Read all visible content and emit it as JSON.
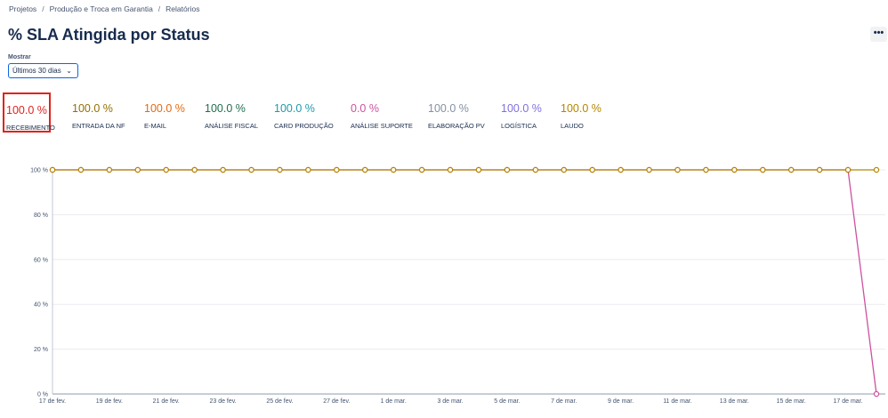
{
  "breadcrumb": [
    "Projetos",
    "Produção e Troca em Garantia",
    "Relatórios"
  ],
  "page_title": "% SLA Atingida por Status",
  "more_label": "•••",
  "filter": {
    "label": "Mostrar",
    "selected": "Últimos 30 dias"
  },
  "stats": [
    {
      "value": "100.0 %",
      "label": "RECEBIMENTO",
      "color": "#e0231c"
    },
    {
      "value": "100.0 %",
      "label": "ENTRADA DA NF",
      "color": "#946f00"
    },
    {
      "value": "100.0 %",
      "label": "E-MAIL",
      "color": "#e56910"
    },
    {
      "value": "100.0 %",
      "label": "ANÁLISE FISCAL",
      "color": "#216e4e"
    },
    {
      "value": "100.0 %",
      "label": "CARD PRODUÇÃO",
      "color": "#1d9aaa"
    },
    {
      "value": "0.0 %",
      "label": "ANÁLISE SUPORTE",
      "color": "#cd519d"
    },
    {
      "value": "100.0 %",
      "label": "ELABORAÇÃO PV",
      "color": "#8590a2"
    },
    {
      "value": "100.0 %",
      "label": "LOGÍSTICA",
      "color": "#8270db"
    },
    {
      "value": "100.0 %",
      "label": "LAUDO",
      "color": "#b38600"
    }
  ],
  "chart_data": {
    "type": "line",
    "y_ticks": [
      "100 %",
      "80 %",
      "60 %",
      "40 %",
      "20 %",
      "0 %"
    ],
    "ylim": [
      0,
      100
    ],
    "x_tick_labels": [
      "17 de fev.",
      "19 de fev.",
      "21 de fev.",
      "23 de fev.",
      "25 de fev.",
      "27 de fev.",
      "1 de mar.",
      "3 de mar.",
      "5 de mar.",
      "7 de mar.",
      "9 de mar.",
      "11 de mar.",
      "13 de mar.",
      "15 de mar.",
      "17 de mar."
    ],
    "grid": true,
    "series": [
      {
        "color": "#b38600",
        "values": [
          100,
          100,
          100,
          100,
          100,
          100,
          100,
          100,
          100,
          100,
          100,
          100,
          100,
          100,
          100,
          100,
          100,
          100,
          100,
          100,
          100,
          100,
          100,
          100,
          100,
          100,
          100,
          100,
          100,
          100
        ]
      },
      {
        "color": "#cd519d",
        "values": [
          100,
          100,
          100,
          100,
          100,
          100,
          100,
          100,
          100,
          100,
          100,
          100,
          100,
          100,
          100,
          100,
          100,
          100,
          100,
          100,
          100,
          100,
          100,
          100,
          100,
          100,
          100,
          100,
          100,
          0
        ]
      }
    ]
  }
}
